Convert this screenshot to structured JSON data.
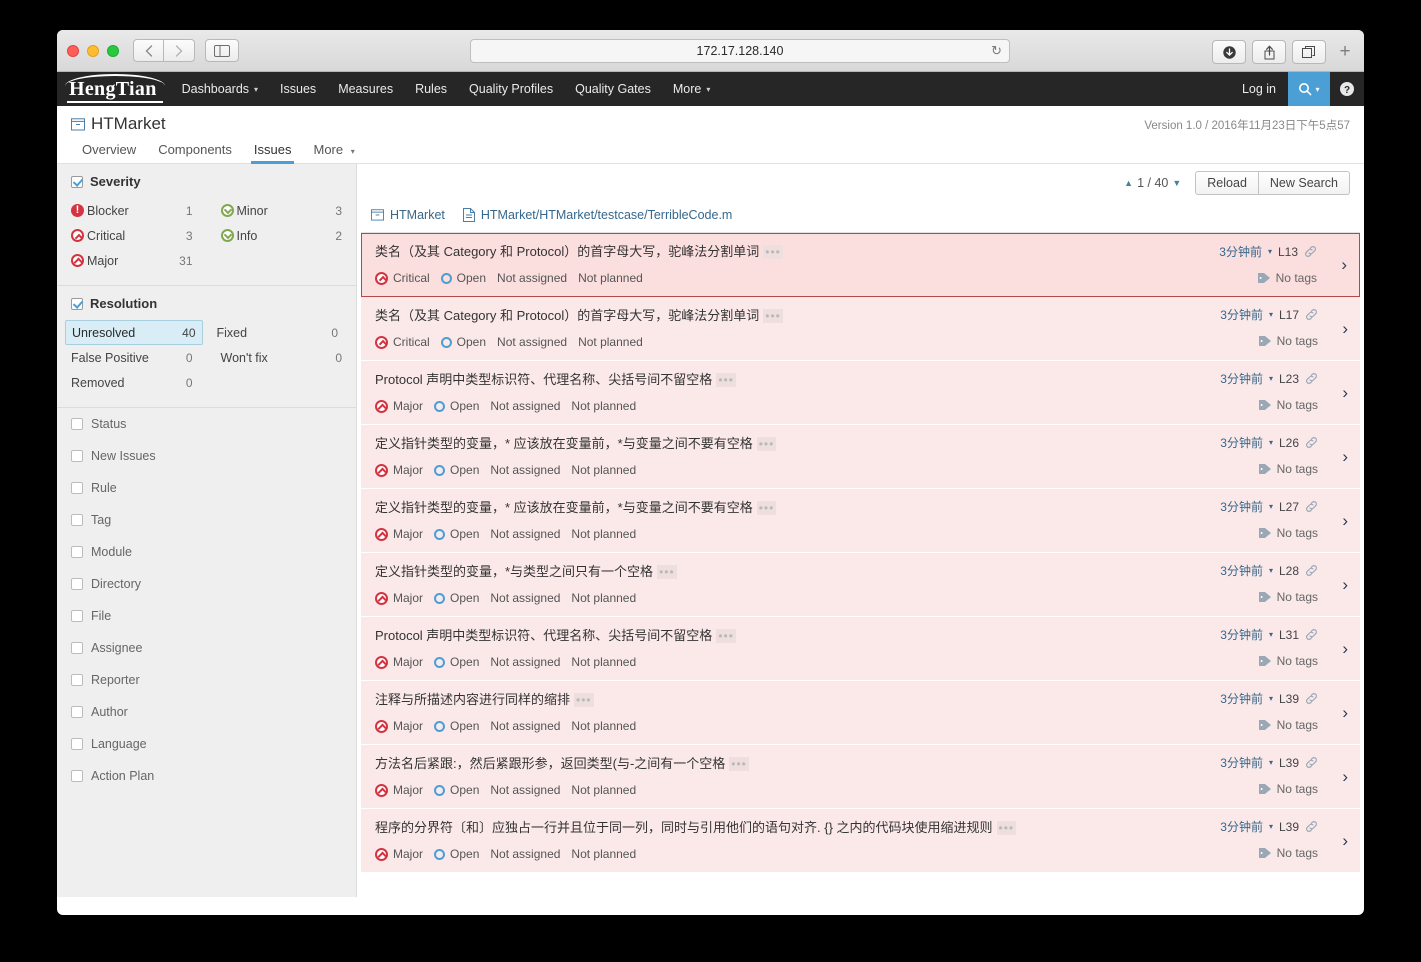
{
  "browser": {
    "url": "172.17.128.140",
    "back_icon": "chevron-left-icon",
    "forward_icon": "chevron-right-icon",
    "sidebar_icon": "sidebar-toggle-icon",
    "reload_icon": "reload-icon",
    "download_icon": "download-icon",
    "share_icon": "share-icon",
    "tabs_icon": "tab-overview-icon",
    "newtab_label": "+"
  },
  "nav": {
    "brand": "HengTian",
    "items": [
      {
        "label": "Dashboards",
        "caret": "▾"
      },
      {
        "label": "Issues",
        "caret": ""
      },
      {
        "label": "Measures",
        "caret": ""
      },
      {
        "label": "Rules",
        "caret": ""
      },
      {
        "label": "Quality Profiles",
        "caret": ""
      },
      {
        "label": "Quality Gates",
        "caret": ""
      },
      {
        "label": "More",
        "caret": "▾"
      }
    ],
    "login_label": "Log in",
    "search_icon": "search-icon",
    "search_caret": "▾",
    "help_icon": "help-icon"
  },
  "project": {
    "icon": "project-icon",
    "name": "HTMarket",
    "version": "Version 1.0 / 2016年11月23日下午5点57"
  },
  "tabs": [
    {
      "label": "Overview",
      "active": false,
      "caret": ""
    },
    {
      "label": "Components",
      "active": false,
      "caret": ""
    },
    {
      "label": "Issues",
      "active": true,
      "caret": ""
    },
    {
      "label": "More",
      "active": false,
      "caret": "▾"
    }
  ],
  "sidebar": {
    "severity": {
      "title": "Severity",
      "checked": true,
      "items": [
        {
          "label": "Blocker",
          "count": "1",
          "icon": "severity-blocker-icon",
          "cls": "blocker"
        },
        {
          "label": "Minor",
          "count": "3",
          "icon": "severity-minor-icon",
          "cls": "minor"
        },
        {
          "label": "Critical",
          "count": "3",
          "icon": "severity-critical-icon",
          "cls": "critical"
        },
        {
          "label": "Info",
          "count": "2",
          "icon": "severity-info-icon",
          "cls": "info"
        },
        {
          "label": "Major",
          "count": "31",
          "icon": "severity-major-icon",
          "cls": "major"
        }
      ]
    },
    "resolution": {
      "title": "Resolution",
      "checked": true,
      "items": [
        {
          "label": "Unresolved",
          "count": "40",
          "selected": true
        },
        {
          "label": "Fixed",
          "count": "0",
          "selected": false
        },
        {
          "label": "False Positive",
          "count": "0",
          "selected": false
        },
        {
          "label": "Won't fix",
          "count": "0",
          "selected": false
        },
        {
          "label": "Removed",
          "count": "0",
          "selected": false
        }
      ]
    },
    "filters": [
      {
        "label": "Status"
      },
      {
        "label": "New Issues"
      },
      {
        "label": "Rule"
      },
      {
        "label": "Tag"
      },
      {
        "label": "Module"
      },
      {
        "label": "Directory"
      },
      {
        "label": "File"
      },
      {
        "label": "Assignee"
      },
      {
        "label": "Reporter"
      },
      {
        "label": "Author"
      },
      {
        "label": "Language"
      },
      {
        "label": "Action Plan"
      }
    ]
  },
  "toolbar": {
    "page_up_arrow": "▲",
    "page_label": "1 / 40",
    "page_down_arrow": "▼",
    "reload_label": "Reload",
    "new_search_label": "New Search"
  },
  "breadcrumb": {
    "project_icon": "project-icon",
    "project_label": "HTMarket",
    "file_icon": "file-icon",
    "file_label": "HTMarket/HTMarket/testcase/TerribleCode.m"
  },
  "issues": [
    {
      "title": "类名（及其 Category 和 Protocol）的首字母大写，驼峰法分割单词",
      "ellipsis": "•••",
      "severity": "Critical",
      "severity_cls": "critical",
      "severity_icon": "severity-critical-icon",
      "status": "Open",
      "assignee": "Not assigned",
      "plan": "Not planned",
      "time": "3分钟前",
      "time_caret": "▾",
      "line": "L13",
      "permalink_icon": "permalink-icon",
      "tags_icon": "tag-icon",
      "tags": "No tags",
      "chevron": "›",
      "selected": true
    },
    {
      "title": "类名（及其 Category 和 Protocol）的首字母大写，驼峰法分割单词",
      "ellipsis": "•••",
      "severity": "Critical",
      "severity_cls": "critical",
      "severity_icon": "severity-critical-icon",
      "status": "Open",
      "assignee": "Not assigned",
      "plan": "Not planned",
      "time": "3分钟前",
      "time_caret": "▾",
      "line": "L17",
      "permalink_icon": "permalink-icon",
      "tags_icon": "tag-icon",
      "tags": "No tags",
      "chevron": "›",
      "selected": false
    },
    {
      "title": "Protocol 声明中类型标识符、代理名称、尖括号间不留空格",
      "ellipsis": "•••",
      "severity": "Major",
      "severity_cls": "major",
      "severity_icon": "severity-major-icon",
      "status": "Open",
      "assignee": "Not assigned",
      "plan": "Not planned",
      "time": "3分钟前",
      "time_caret": "▾",
      "line": "L23",
      "permalink_icon": "permalink-icon",
      "tags_icon": "tag-icon",
      "tags": "No tags",
      "chevron": "›",
      "selected": false
    },
    {
      "title": "定义指针类型的变量，* 应该放在变量前，*与变量之间不要有空格",
      "ellipsis": "•••",
      "severity": "Major",
      "severity_cls": "major",
      "severity_icon": "severity-major-icon",
      "status": "Open",
      "assignee": "Not assigned",
      "plan": "Not planned",
      "time": "3分钟前",
      "time_caret": "▾",
      "line": "L26",
      "permalink_icon": "permalink-icon",
      "tags_icon": "tag-icon",
      "tags": "No tags",
      "chevron": "›",
      "selected": false
    },
    {
      "title": "定义指针类型的变量，* 应该放在变量前，*与变量之间不要有空格",
      "ellipsis": "•••",
      "severity": "Major",
      "severity_cls": "major",
      "severity_icon": "severity-major-icon",
      "status": "Open",
      "assignee": "Not assigned",
      "plan": "Not planned",
      "time": "3分钟前",
      "time_caret": "▾",
      "line": "L27",
      "permalink_icon": "permalink-icon",
      "tags_icon": "tag-icon",
      "tags": "No tags",
      "chevron": "›",
      "selected": false
    },
    {
      "title": "定义指针类型的变量，*与类型之间只有一个空格",
      "ellipsis": "•••",
      "severity": "Major",
      "severity_cls": "major",
      "severity_icon": "severity-major-icon",
      "status": "Open",
      "assignee": "Not assigned",
      "plan": "Not planned",
      "time": "3分钟前",
      "time_caret": "▾",
      "line": "L28",
      "permalink_icon": "permalink-icon",
      "tags_icon": "tag-icon",
      "tags": "No tags",
      "chevron": "›",
      "selected": false
    },
    {
      "title": "Protocol 声明中类型标识符、代理名称、尖括号间不留空格",
      "ellipsis": "•••",
      "severity": "Major",
      "severity_cls": "major",
      "severity_icon": "severity-major-icon",
      "status": "Open",
      "assignee": "Not assigned",
      "plan": "Not planned",
      "time": "3分钟前",
      "time_caret": "▾",
      "line": "L31",
      "permalink_icon": "permalink-icon",
      "tags_icon": "tag-icon",
      "tags": "No tags",
      "chevron": "›",
      "selected": false
    },
    {
      "title": "注释与所描述内容进行同样的缩排",
      "ellipsis": "•••",
      "severity": "Major",
      "severity_cls": "major",
      "severity_icon": "severity-major-icon",
      "status": "Open",
      "assignee": "Not assigned",
      "plan": "Not planned",
      "time": "3分钟前",
      "time_caret": "▾",
      "line": "L39",
      "permalink_icon": "permalink-icon",
      "tags_icon": "tag-icon",
      "tags": "No tags",
      "chevron": "›",
      "selected": false
    },
    {
      "title": "方法名后紧跟:，然后紧跟形参，返回类型(与-之间有一个空格",
      "ellipsis": "•••",
      "severity": "Major",
      "severity_cls": "major",
      "severity_icon": "severity-major-icon",
      "status": "Open",
      "assignee": "Not assigned",
      "plan": "Not planned",
      "time": "3分钟前",
      "time_caret": "▾",
      "line": "L39",
      "permalink_icon": "permalink-icon",
      "tags_icon": "tag-icon",
      "tags": "No tags",
      "chevron": "›",
      "selected": false
    },
    {
      "title": "程序的分界符〔和〕应独占一行并且位于同一列，同时与引用他们的语句对齐. {} 之内的代码块使用缩进规则",
      "ellipsis": "•••",
      "severity": "Major",
      "severity_cls": "major",
      "severity_icon": "severity-major-icon",
      "status": "Open",
      "assignee": "Not assigned",
      "plan": "Not planned",
      "time": "3分钟前",
      "time_caret": "▾",
      "line": "L39",
      "permalink_icon": "permalink-icon",
      "tags_icon": "tag-icon",
      "tags": "No tags",
      "chevron": "›",
      "selected": false
    }
  ],
  "colors": {
    "accent": "#4b9fd5",
    "severity_red": "#d4333f",
    "severity_green": "#80a84e",
    "issue_bg": "#fbe9e9",
    "nav_bg": "#262626"
  }
}
